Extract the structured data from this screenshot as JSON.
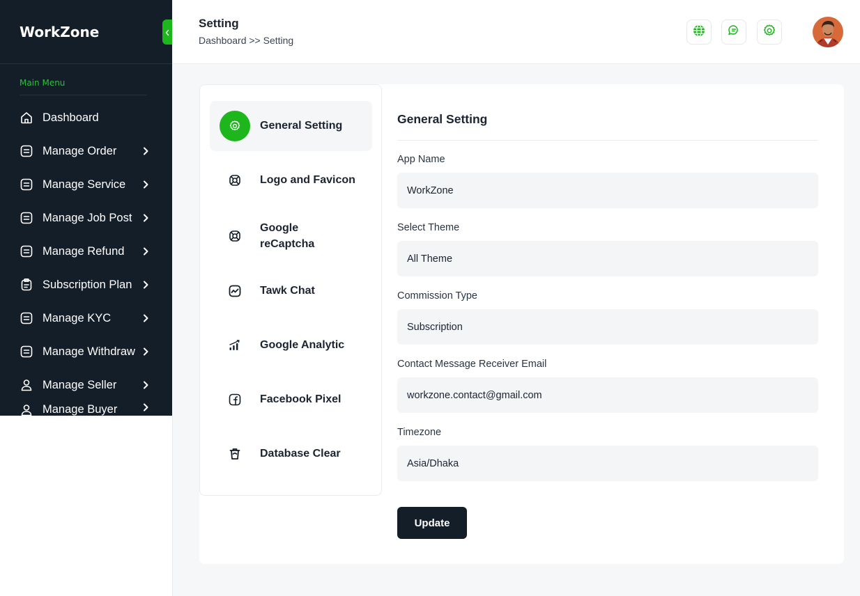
{
  "brand": {
    "name": "WorkZone"
  },
  "sidebar": {
    "caption": "Main Menu",
    "items": [
      {
        "label": "Dashboard",
        "icon": "home-icon",
        "has_chevron": false
      },
      {
        "label": "Manage Order",
        "icon": "list-icon",
        "has_chevron": true
      },
      {
        "label": "Manage Service",
        "icon": "list-icon",
        "has_chevron": true
      },
      {
        "label": "Manage Job Post",
        "icon": "list-icon",
        "has_chevron": true
      },
      {
        "label": "Manage Refund",
        "icon": "list-icon",
        "has_chevron": true
      },
      {
        "label": "Subscription Plan",
        "icon": "clipboard-icon",
        "has_chevron": true
      },
      {
        "label": "Manage KYC",
        "icon": "list-icon",
        "has_chevron": true
      },
      {
        "label": "Manage Withdraw",
        "icon": "list-icon",
        "has_chevron": true
      },
      {
        "label": "Manage Seller",
        "icon": "user-icon",
        "has_chevron": true
      },
      {
        "label": "Manage Buyer",
        "icon": "user-icon",
        "has_chevron": true
      }
    ]
  },
  "header": {
    "title": "Setting",
    "breadcrumb": "Dashboard >> Setting",
    "icons": [
      "globe-icon",
      "chat-icon",
      "gear-icon"
    ]
  },
  "settings_tabs": [
    {
      "label": "General Setting",
      "icon": "gear-icon",
      "active": true
    },
    {
      "label": "Logo and Favicon",
      "icon": "lifebuoy-icon",
      "active": false
    },
    {
      "label": "Google reCaptcha",
      "icon": "lifebuoy-icon",
      "active": false
    },
    {
      "label": "Tawk Chat",
      "icon": "activity-icon",
      "active": false
    },
    {
      "label": "Google Analytic",
      "icon": "signal-bars-icon",
      "active": false
    },
    {
      "label": "Facebook Pixel",
      "icon": "facebook-icon",
      "active": false
    },
    {
      "label": "Database Clear",
      "icon": "trash-icon",
      "active": false
    }
  ],
  "form": {
    "title": "General Setting",
    "fields": [
      {
        "label": "App Name",
        "value": "WorkZone"
      },
      {
        "label": "Select Theme",
        "value": "All Theme"
      },
      {
        "label": "Commission Type",
        "value": "Subscription"
      },
      {
        "label": "Contact Message Receiver Email",
        "value": "workzone.contact@gmail.com"
      },
      {
        "label": "Timezone",
        "value": "Asia/Dhaka"
      }
    ],
    "submit_label": "Update"
  },
  "colors": {
    "accent": "#1db61d",
    "sidebar_bg": "#141e29",
    "page_bg": "#f6f7f9",
    "input_bg": "#f4f5f7"
  }
}
